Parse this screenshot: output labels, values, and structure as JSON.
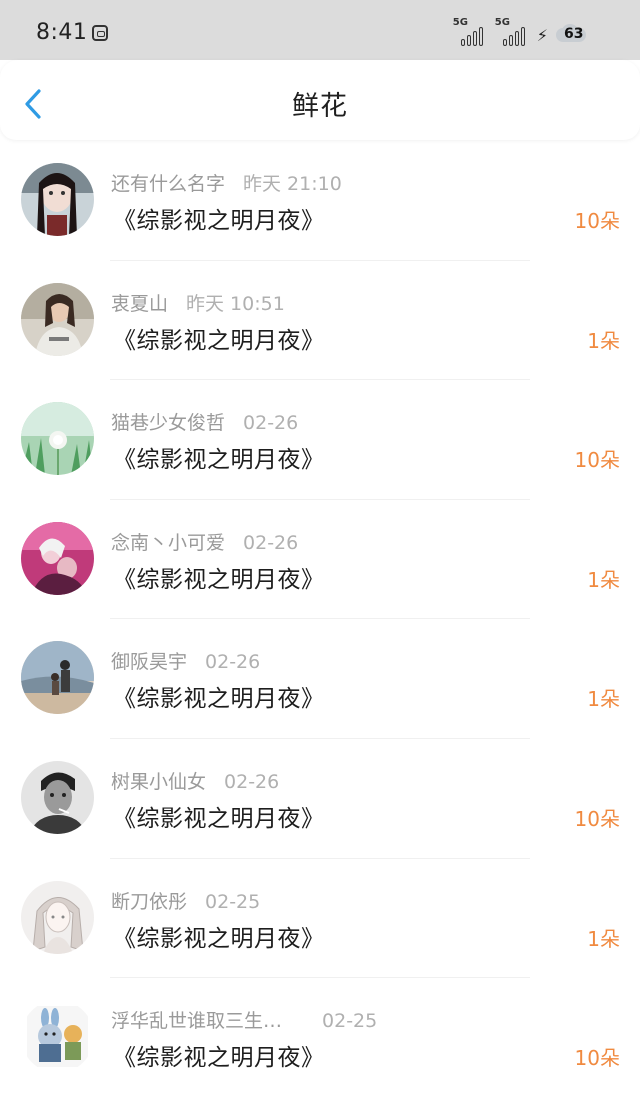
{
  "status_bar": {
    "time": "8:41",
    "network_1": "5G",
    "network_2": "5G",
    "battery": "63"
  },
  "header": {
    "title": "鲜花",
    "back_icon": "chevron-left-icon"
  },
  "accent_colors": {
    "back": "#2f9be4",
    "count": "#f08a40"
  },
  "items": [
    {
      "name": "还有什么名字",
      "time": "昨天 21:10",
      "title": "《综影视之明月夜》",
      "count": "10朵"
    },
    {
      "name": "衷夏山",
      "time": "昨天 10:51",
      "title": "《综影视之明月夜》",
      "count": "1朵"
    },
    {
      "name": "猫巷少女俊哲",
      "time": "02-26",
      "title": "《综影视之明月夜》",
      "count": "10朵"
    },
    {
      "name": "念南丶小可爱",
      "time": "02-26",
      "title": "《综影视之明月夜》",
      "count": "1朵"
    },
    {
      "name": "御阪昊宇",
      "time": "02-26",
      "title": "《综影视之明月夜》",
      "count": "1朵"
    },
    {
      "name": "树果小仙女",
      "time": "02-26",
      "title": "《综影视之明月夜》",
      "count": "10朵"
    },
    {
      "name": "断刀依彤",
      "time": "02-25",
      "title": "《综影视之明月夜》",
      "count": "1朵"
    },
    {
      "name": "浮华乱世谁取三生…",
      "time": "02-25",
      "title": "《综影视之明月夜》",
      "count": "10朵"
    }
  ]
}
